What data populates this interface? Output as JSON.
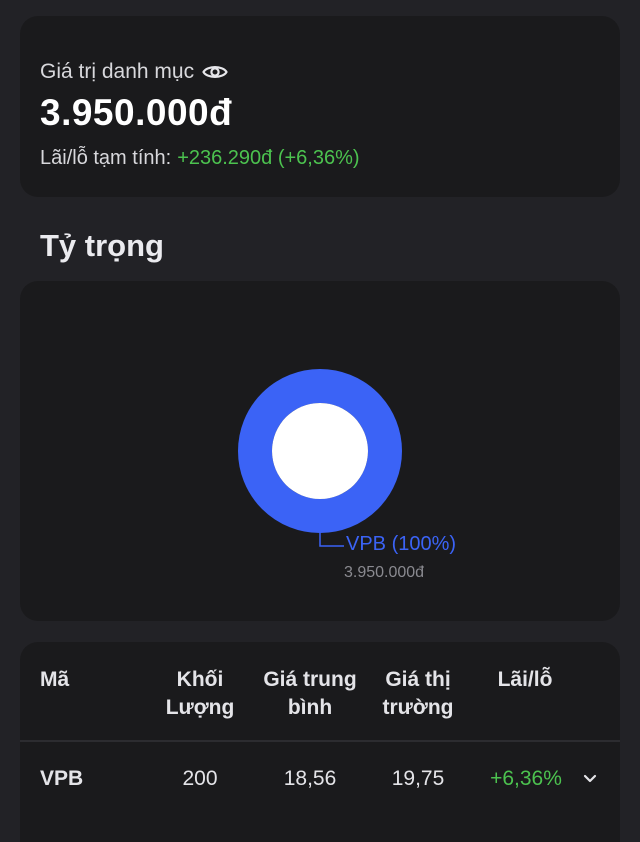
{
  "summary": {
    "label": "Giá trị danh mục",
    "total_value": "3.950.000đ",
    "pnl_label": "Lãi/lỗ tạm tính:",
    "pnl_value": "+236.290đ (+6,36%)"
  },
  "allocation": {
    "title": "Tỷ trọng",
    "chart_data": {
      "type": "pie",
      "categories": [
        "VPB"
      ],
      "values": [
        100
      ],
      "labels": [
        "VPB (100%)"
      ],
      "sub_labels": [
        "3.950.000đ"
      ],
      "colors": [
        "#3b63f6"
      ]
    }
  },
  "holdings": {
    "headers": {
      "code": "Mã",
      "qty_line1": "Khối",
      "qty_line2": "Lượng",
      "avg_line1": "Giá trung",
      "avg_line2": "bình",
      "mkt_line1": "Giá thị",
      "mkt_line2": "trường",
      "pnl": "Lãi/lỗ"
    },
    "rows": [
      {
        "code": "VPB",
        "quantity": "200",
        "avg_price": "18,56",
        "market_price": "19,75",
        "pnl_pct": "+6,36%"
      }
    ]
  },
  "colors": {
    "background": "#222226",
    "card": "#1a1a1c",
    "accent_blue": "#3b63f6",
    "positive_green": "#4cc24f"
  },
  "icons": {
    "visibility": "eye-icon",
    "expand": "chevron-down-icon"
  }
}
